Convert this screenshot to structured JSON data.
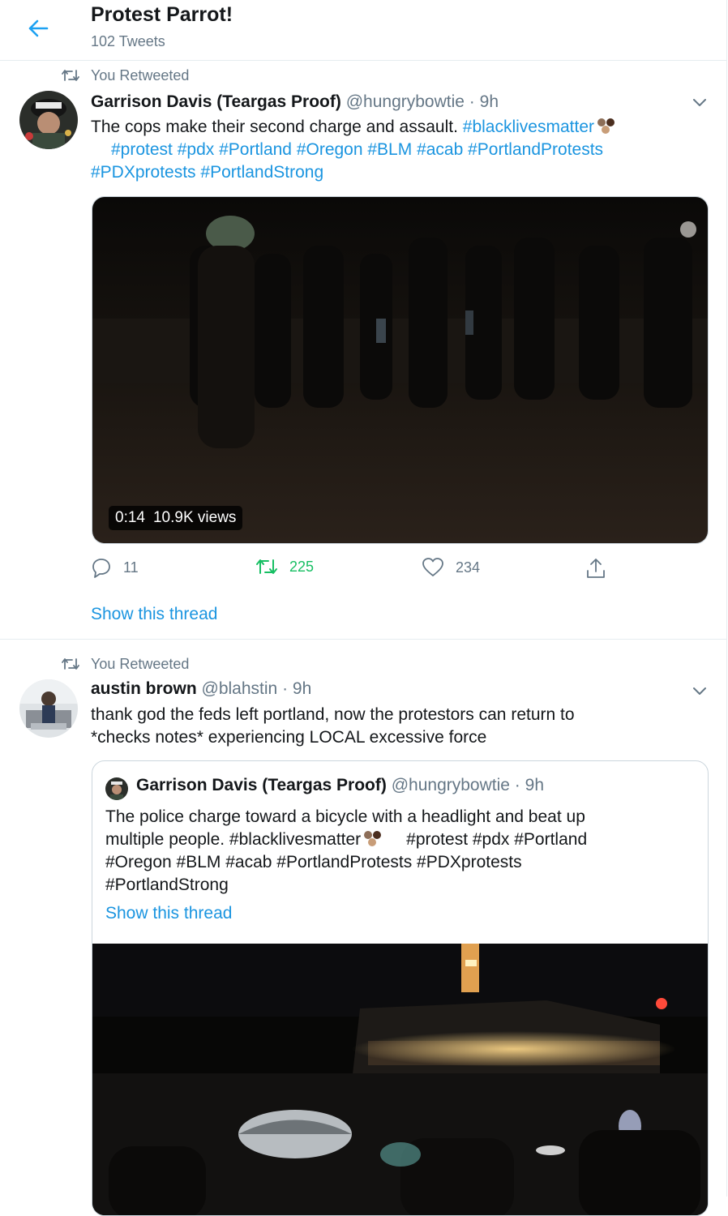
{
  "header": {
    "title": "Protest Parrot!",
    "subtitle": "102 Tweets",
    "back_icon": "arrow-left-icon"
  },
  "tweets": [
    {
      "retweet_label": "You Retweeted",
      "name": "Garrison Davis (Teargas Proof)",
      "handle": "@hungrybowtie",
      "sep": "·",
      "time": "9h",
      "text_lines": [
        [
          "The cops make their second charge and assault. ",
          "#blacklivesmatter"
        ],
        [
          "#protest #pdx #Portland #Oregon #BLM #acab #PortlandProtests"
        ],
        [
          "#PDXprotests #PortlandStrong"
        ]
      ],
      "video": {
        "duration": "0:14",
        "views": "10.9K views"
      },
      "actions": {
        "replies": "11",
        "retweets": "225",
        "likes": "234"
      },
      "show_thread": "Show this thread"
    },
    {
      "retweet_label": "You Retweeted",
      "name": "austin brown",
      "handle": "@blahstin",
      "sep": "·",
      "time": "9h",
      "text_lines": [
        "thank god the feds left portland, now the protestors can return to",
        "*checks notes* experiencing LOCAL excessive force"
      ],
      "quote": {
        "name": "Garrison Davis (Teargas Proof)",
        "handle": "@hungrybowtie",
        "sep": "·",
        "time": "9h",
        "lines": [
          "The police charge toward a bicycle with a headlight and beat up",
          "multiple people. #blacklivesmatter",
          "#protest #pdx #Portland",
          "#Oregon #BLM #acab #PortlandProtests #PDXprotests",
          "#PortlandStrong"
        ],
        "show_thread": "Show this thread"
      }
    }
  ],
  "colors": {
    "link": "#1b95e0",
    "secondary": "#657786",
    "retweet_green": "#17bf63",
    "border": "#e6ecf0"
  }
}
